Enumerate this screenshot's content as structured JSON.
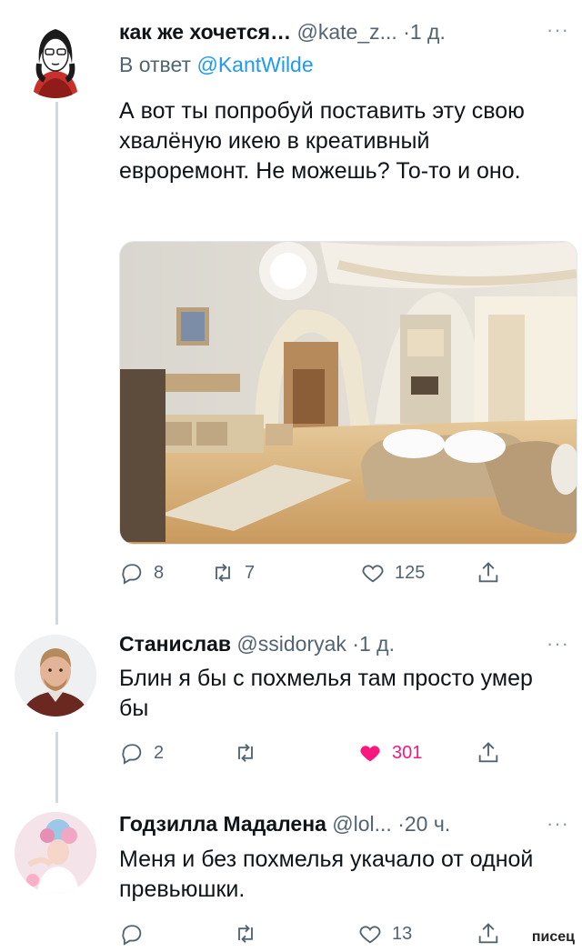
{
  "tweets": [
    {
      "name": "как же хочется…",
      "handle": "@kate_z...",
      "time": "·1 д.",
      "more": "···",
      "reply_prefix": "В ответ",
      "reply_handle": "@KantWilde",
      "text": "А вот ты попробуй поставить эту свою хвалёную икею в креативный евроремонт. Не можешь? То-то и оно.",
      "replies": "8",
      "retweets": "7",
      "likes": "125",
      "liked": false
    },
    {
      "name": "Станислав",
      "handle": "@ssidoryak",
      "time": "·1 д.",
      "more": "···",
      "text": "Блин я бы с похмелья там просто умер бы",
      "replies": "2",
      "retweets": "",
      "likes": "301",
      "liked": true
    },
    {
      "name": "Годзилла Мадалена",
      "handle": "@lol...",
      "time": "·20 ч.",
      "more": "···",
      "text": "Меня и без похмелья укачало от одной превьюшки.",
      "replies": "",
      "retweets": "",
      "likes": "13",
      "liked": false
    }
  ],
  "watermark": "писец",
  "colors": {
    "link": "#1d9bf0",
    "muted": "#536471",
    "like": "#f91880",
    "thread": "#cfd9de"
  }
}
